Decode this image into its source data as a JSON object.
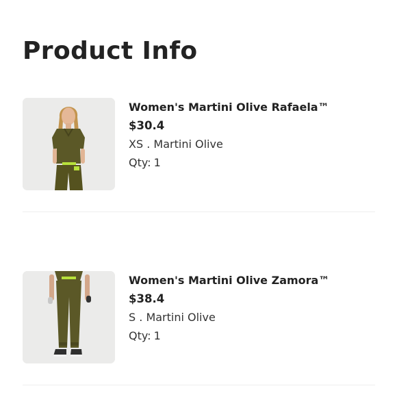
{
  "page": {
    "title": "Product Info"
  },
  "items": [
    {
      "name": "Women's Martini Olive Rafaela™",
      "price": "$30.4",
      "size": "XS",
      "separator": ".",
      "color_name": "Martini Olive",
      "qty_label": "Qty:",
      "qty": "1",
      "image_icon": "scrubs-top-and-pants-photo"
    },
    {
      "name": "Women's Martini Olive Zamora™",
      "price": "$38.4",
      "size": "S",
      "separator": ".",
      "color_name": "Martini Olive",
      "qty_label": "Qty:",
      "qty": "1",
      "image_icon": "scrubs-jogger-pants-photo"
    }
  ],
  "colors": {
    "olive": "#5b5827",
    "accent_green": "#b7e13b",
    "thumb_bg": "#ebebea",
    "divider": "#eeeeee"
  }
}
